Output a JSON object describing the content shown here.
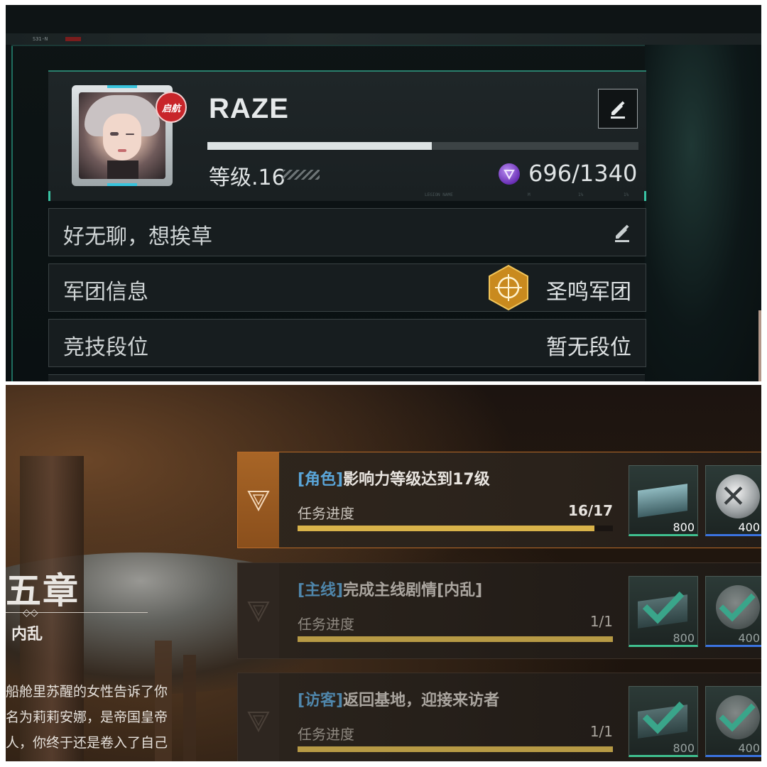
{
  "profile": {
    "player_name": "RAZE",
    "avatar_badge": "启航",
    "level_label": "等级.16",
    "xp_progress": 0.52,
    "xp_text": "696/1340",
    "signature": "好无聊，想挨草",
    "legion_label": "军团信息",
    "legion_name": "圣鸣军团",
    "rank_label": "竞技段位",
    "rank_value": "暂无段位",
    "tiny_code": "S31-N",
    "faint_text": [
      "LEGION NAME",
      "M",
      "1%",
      "1%"
    ]
  },
  "story": {
    "chapter": "五章",
    "chapter_subtitle": "内乱",
    "lines": [
      "船舱里苏醒的女性告诉了你",
      "名为莉莉安娜，是帝国皇帝",
      "人，你终于还是卷入了自己"
    ]
  },
  "quests": [
    {
      "tag": "[角色]",
      "title": "影响力等级达到17级",
      "progress_label": "任务进度",
      "progress_text": "16/17",
      "progress": 0.9412,
      "status": "active",
      "rewards": [
        {
          "icon": "material-crate-icon",
          "amount": "800"
        },
        {
          "icon": "credit-disc-icon",
          "amount": "400"
        }
      ]
    },
    {
      "tag": "[主线]",
      "title": "完成主线剧情[内乱]",
      "progress_label": "任务进度",
      "progress_text": "1/1",
      "progress": 1,
      "status": "done",
      "rewards": [
        {
          "icon": "material-crate-icon",
          "amount": "800"
        },
        {
          "icon": "credit-disc-icon",
          "amount": "400"
        }
      ]
    },
    {
      "tag": "[访客]",
      "title": "返回基地，迎接来访者",
      "progress_label": "任务进度",
      "progress_text": "1/1",
      "progress": 1,
      "status": "done",
      "rewards": [
        {
          "icon": "material-crate-icon",
          "amount": "800"
        },
        {
          "icon": "credit-disc-icon",
          "amount": "400"
        }
      ]
    }
  ],
  "colors": {
    "accent_teal": "#39c2a3",
    "quest_tag_blue": "#5aa5d8",
    "progress_gold": "#d9b34a",
    "active_orange": "#b86a28"
  }
}
